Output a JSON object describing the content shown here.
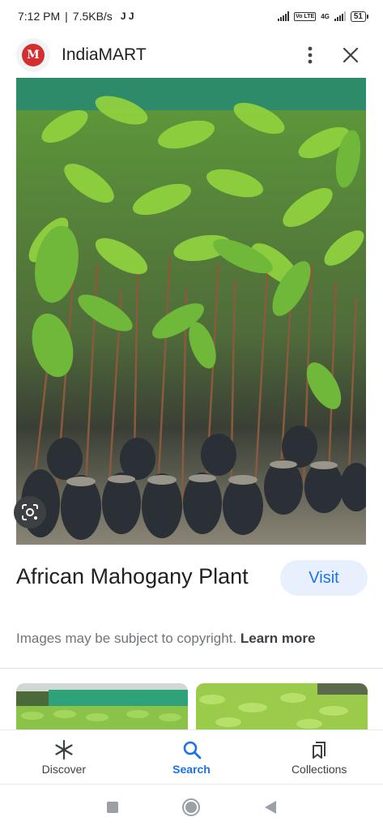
{
  "status": {
    "time": "7:12 PM",
    "speed": "7.5KB/s",
    "notif_icons": "J J",
    "network": "4G",
    "volte": "Vo LTE",
    "battery": "51"
  },
  "header": {
    "site_name": "IndiaMART",
    "logo_letter": "M",
    "icons": [
      "more-vert-icon",
      "close-icon"
    ]
  },
  "result": {
    "title": "African Mahogany Plant",
    "visit_label": "Visit",
    "copyright_text": "Images may be subject to copyright.",
    "learn_more": "Learn more"
  },
  "bottom_nav": {
    "items": [
      {
        "label": "Discover",
        "icon": "asterisk-icon"
      },
      {
        "label": "Search",
        "icon": "search-icon",
        "active": true
      },
      {
        "label": "Collections",
        "icon": "bookmark-icon"
      }
    ]
  },
  "system_nav": [
    "recent-apps-icon",
    "home-icon",
    "back-icon"
  ],
  "colors": {
    "accent": "#1a73e8",
    "visit_bg": "#e8f0fe",
    "logo_red": "#d32f2f",
    "leaf_green": "#7cbf2e"
  }
}
